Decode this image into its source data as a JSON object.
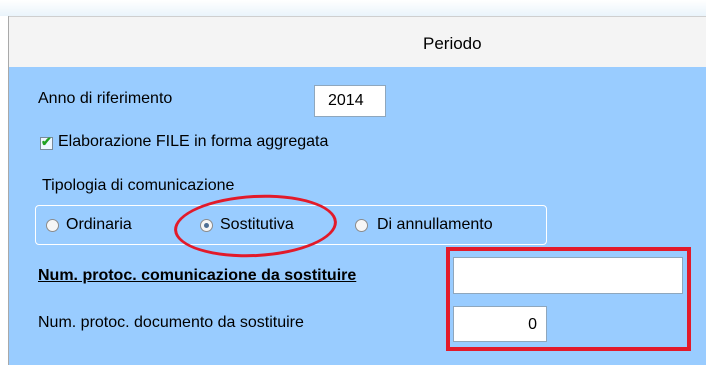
{
  "header": {
    "title": "Periodo"
  },
  "form": {
    "anno_label": "Anno di riferimento",
    "anno_value": "2014",
    "aggregata_label": "Elaborazione FILE in forma aggregata",
    "aggregata_checked": true,
    "tipologia_label": "Tipologia di comunicazione",
    "options": [
      "Ordinaria",
      "Sostitutiva",
      "Di annullamento"
    ],
    "selected_option": "Sostitutiva",
    "num_protoc_comunicazione_label": "Num. protoc. comunicazione da sostituire",
    "num_protoc_comunicazione_value": "",
    "num_protoc_documento_label": "Num. protoc. documento da sostituire",
    "num_protoc_documento_value": "0"
  },
  "colors": {
    "panel_bg": "#99ccff",
    "annotation_red": "#e21a2a"
  }
}
